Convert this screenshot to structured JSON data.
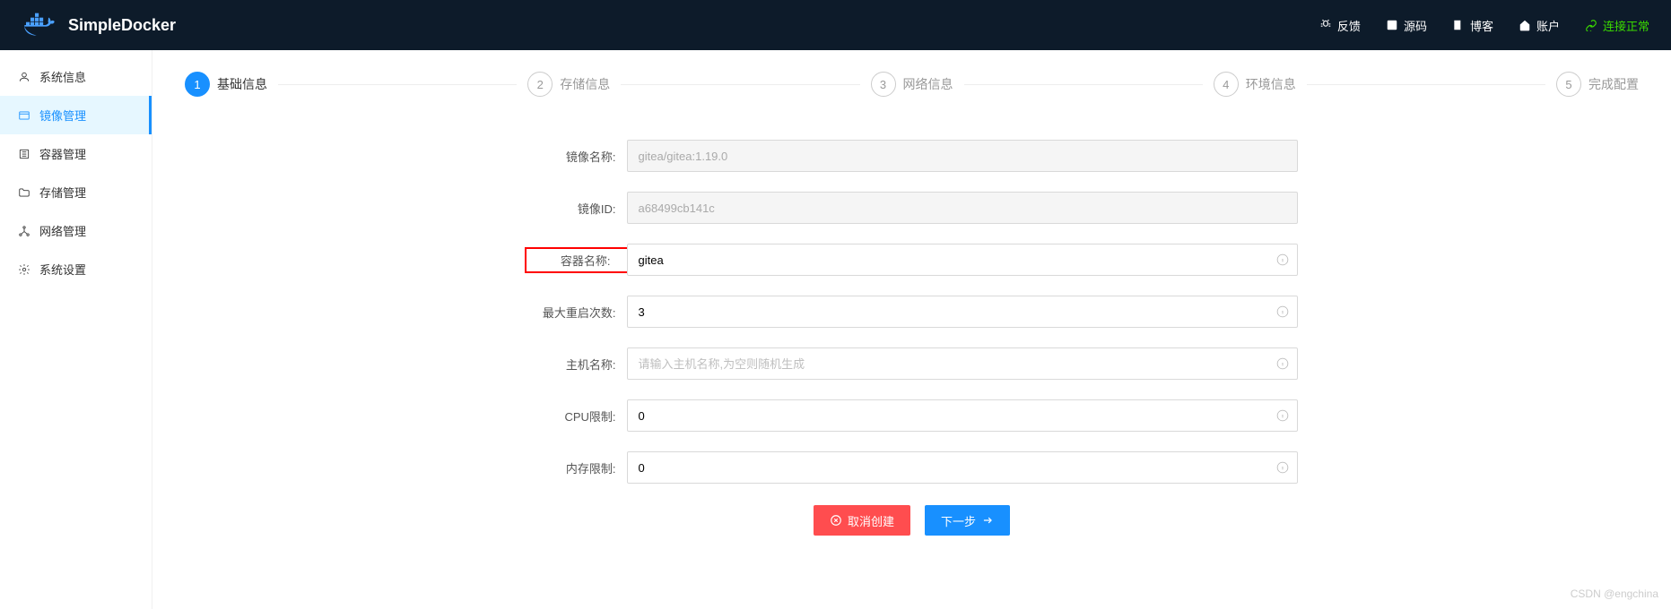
{
  "header": {
    "brand": "SimpleDocker",
    "links": {
      "feedback": "反馈",
      "source": "源码",
      "blog": "博客",
      "account": "账户",
      "status": "连接正常"
    }
  },
  "sidebar": {
    "items": [
      {
        "label": "系统信息"
      },
      {
        "label": "镜像管理"
      },
      {
        "label": "容器管理"
      },
      {
        "label": "存储管理"
      },
      {
        "label": "网络管理"
      },
      {
        "label": "系统设置"
      }
    ]
  },
  "steps": {
    "s1": {
      "num": "1",
      "label": "基础信息"
    },
    "s2": {
      "num": "2",
      "label": "存储信息"
    },
    "s3": {
      "num": "3",
      "label": "网络信息"
    },
    "s4": {
      "num": "4",
      "label": "环境信息"
    },
    "s5": {
      "num": "5",
      "label": "完成配置"
    }
  },
  "form": {
    "image_name": {
      "label": "镜像名称:",
      "value": "gitea/gitea:1.19.0"
    },
    "image_id": {
      "label": "镜像ID:",
      "value": "a68499cb141c"
    },
    "container_name": {
      "label": "容器名称:",
      "value": "gitea"
    },
    "max_restarts": {
      "label": "最大重启次数:",
      "value": "3"
    },
    "hostname": {
      "label": "主机名称:",
      "placeholder": "请输入主机名称,为空则随机生成"
    },
    "cpu_limit": {
      "label": "CPU限制:",
      "value": "0"
    },
    "mem_limit": {
      "label": "内存限制:",
      "value": "0"
    }
  },
  "actions": {
    "cancel": "取消创建",
    "next": "下一步"
  },
  "watermark": "CSDN @engchina"
}
